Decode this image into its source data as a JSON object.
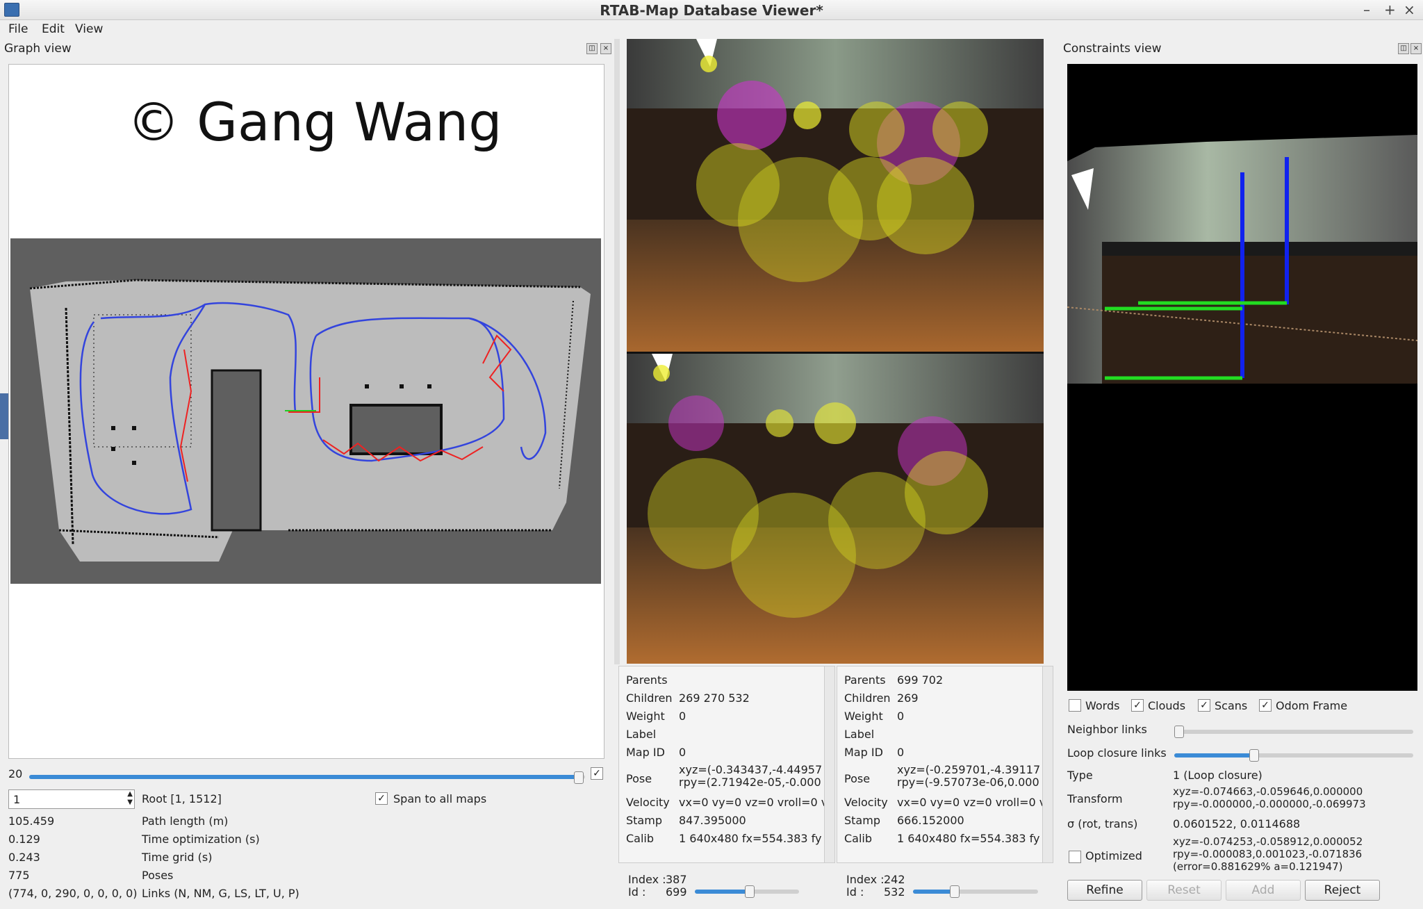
{
  "window": {
    "title": "RTAB-Map Database Viewer*"
  },
  "menu": {
    "file": "File",
    "edit": "Edit",
    "view": "View"
  },
  "graph_view": {
    "title": "Graph view",
    "watermark": "© Gang Wang",
    "slider_value": "20",
    "root_input": "1",
    "root_label": "Root [1, 1512]",
    "span_label": "Span to all maps",
    "stats": [
      {
        "value": "105.459",
        "label": "Path length (m)"
      },
      {
        "value": "0.129",
        "label": "Time optimization (s)"
      },
      {
        "value": "0.243",
        "label": "Time grid (s)"
      },
      {
        "value": "775",
        "label": "Poses"
      },
      {
        "value": "(774, 0, 290, 0, 0, 0, 0)",
        "label": "Links (N, NM, G, LS, LT, U, P)"
      }
    ]
  },
  "left_info": {
    "rows": [
      {
        "key": "Parents",
        "val": ""
      },
      {
        "key": "Children",
        "val": "269 270 532"
      },
      {
        "key": "Weight",
        "val": "0"
      },
      {
        "key": "Label",
        "val": ""
      },
      {
        "key": "Map ID",
        "val": "0"
      },
      {
        "key": "Pose",
        "val": "xyz=(-0.343437,-4.44957\nrpy=(2.71942e-05,-0.000"
      },
      {
        "key": "Velocity",
        "val": "vx=0 vy=0 vz=0 vroll=0 v"
      },
      {
        "key": "Stamp",
        "val": "847.395000"
      },
      {
        "key": "Calib",
        "val": "1 640x480 fx=554.383 fy"
      }
    ],
    "index_label": "Index :",
    "index_value": "387",
    "id_label": "Id :",
    "id_value": "699",
    "slider_fraction": 0.52
  },
  "right_info": {
    "rows": [
      {
        "key": "Parents",
        "val": "699 702"
      },
      {
        "key": "Children",
        "val": "269"
      },
      {
        "key": "Weight",
        "val": "0"
      },
      {
        "key": "Label",
        "val": ""
      },
      {
        "key": "Map ID",
        "val": "0"
      },
      {
        "key": "Pose",
        "val": "xyz=(-0.259701,-4.39117\nrpy=(-9.57073e-06,0.000"
      },
      {
        "key": "Velocity",
        "val": "vx=0 vy=0 vz=0 vroll=0 v"
      },
      {
        "key": "Stamp",
        "val": "666.152000"
      },
      {
        "key": "Calib",
        "val": "1 640x480 fx=554.383 fy"
      }
    ],
    "index_label": "Index :",
    "index_value": "242",
    "id_label": "Id :",
    "id_value": "532",
    "slider_fraction": 0.33
  },
  "constraints_view": {
    "title": "Constraints view",
    "checks": [
      {
        "label": "Words",
        "checked": false
      },
      {
        "label": "Clouds",
        "checked": true
      },
      {
        "label": "Scans",
        "checked": true
      },
      {
        "label": "Odom Frame",
        "checked": true
      }
    ],
    "neighbor_links": "Neighbor links",
    "loop_closure_links": "Loop closure links",
    "type_label": "Type",
    "type_value": "1 (Loop closure)",
    "transform_label": "Transform",
    "transform_value": "xyz=-0.074663,-0.059646,0.000000\nrpy=-0.000000,-0.000000,-0.069973",
    "sigma_label": "σ (rot, trans)",
    "sigma_value": "0.0601522, 0.0114688",
    "optimized_label": "Optimized",
    "optimized_value": "xyz=-0.074253,-0.058912,0.000052\nrpy=-0.000083,0.001023,-0.071836\n(error=0.881629% a=0.121947)",
    "buttons": {
      "refine": "Refine",
      "reset": "Reset",
      "add": "Add",
      "reject": "Reject"
    }
  },
  "colors": {
    "accent": "#3b8bd6",
    "path_blue": "#3344dd",
    "loop_red": "#ee2222",
    "map_free": "#bcbcbc",
    "map_unknown": "#5f5f5f"
  }
}
